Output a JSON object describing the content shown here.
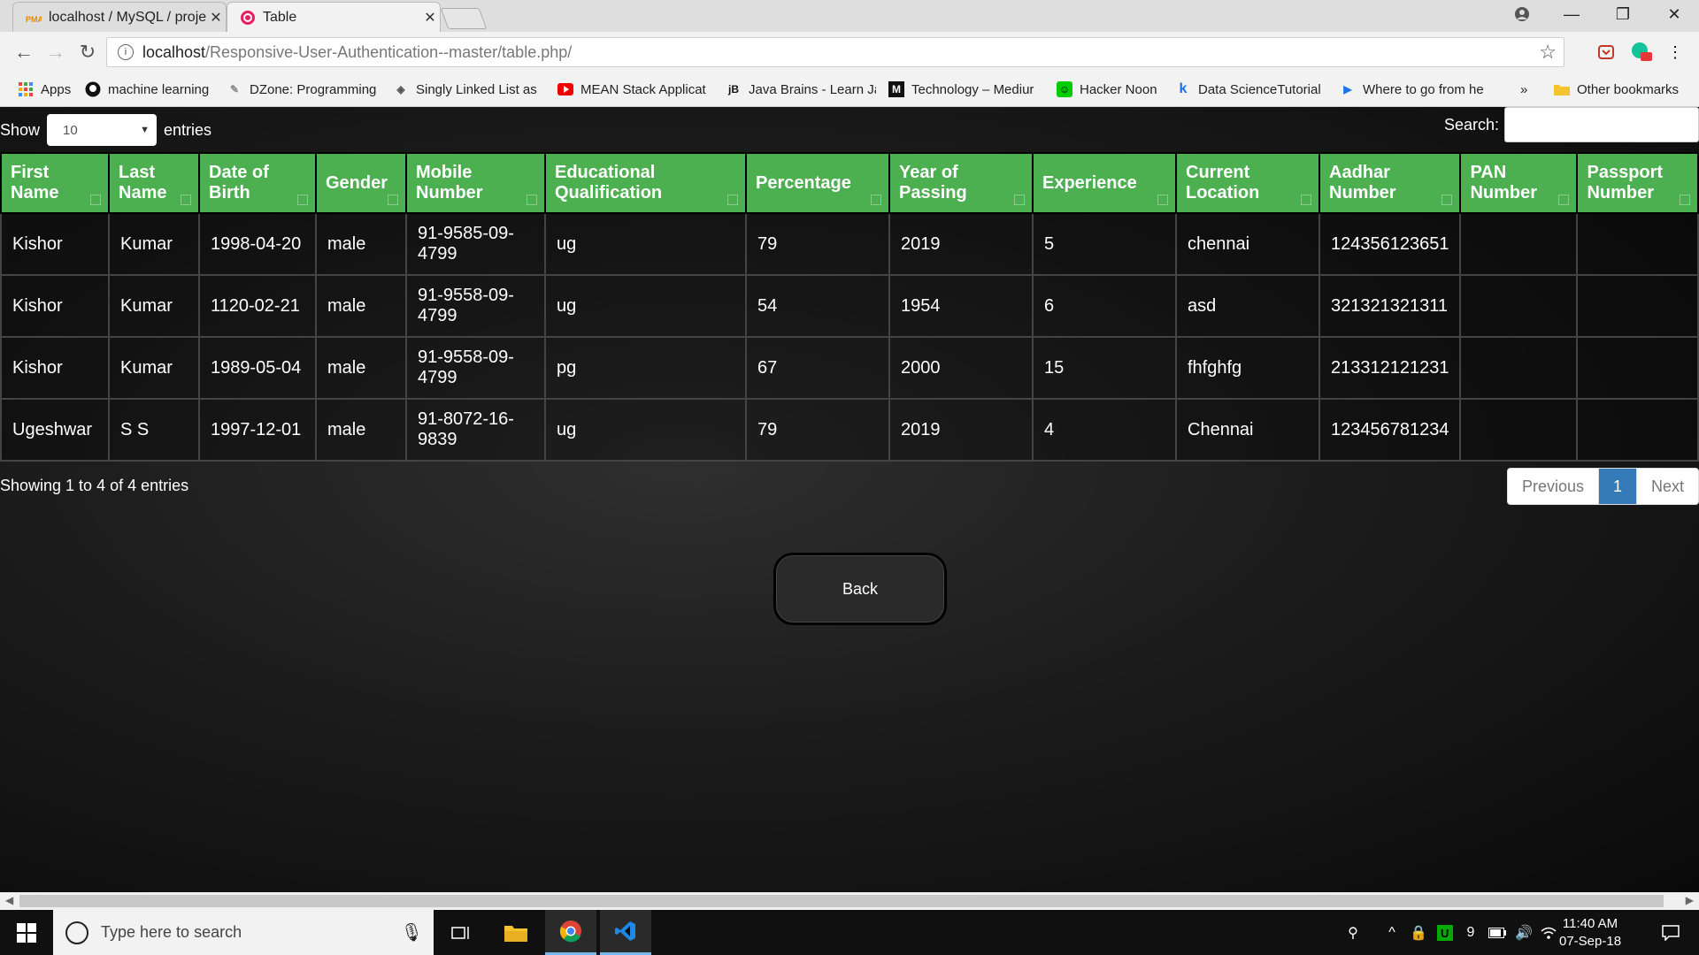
{
  "browser": {
    "tabs": [
      {
        "label": "localhost / MySQL / proje",
        "icon": "phpmyadmin-icon"
      },
      {
        "label": "Table",
        "icon": "page-favicon-icon"
      }
    ],
    "url_host": "localhost",
    "url_path": "/Responsive-User-Authentication--master/table.php/",
    "bookmarks": [
      {
        "label": "Apps",
        "icon": "apps-grid-icon"
      },
      {
        "label": "machine learning",
        "icon": "github-icon"
      },
      {
        "label": "DZone: Programming",
        "icon": "dzone-icon"
      },
      {
        "label": "Singly Linked List as",
        "icon": "diamond-icon"
      },
      {
        "label": "MEAN Stack Applicat",
        "icon": "youtube-icon"
      },
      {
        "label": "Java Brains - Learn Ja",
        "icon": "jb-icon"
      },
      {
        "label": "Technology – Mediur",
        "icon": "medium-icon"
      },
      {
        "label": "Hacker Noon",
        "icon": "hackernoon-icon"
      },
      {
        "label": "Data ScienceTutorial",
        "icon": "kdnuggets-icon"
      },
      {
        "label": "Where to go from he",
        "icon": "video-icon"
      },
      {
        "label": "»",
        "icon": ""
      },
      {
        "label": "Other bookmarks",
        "icon": "folder-icon"
      }
    ]
  },
  "controls": {
    "show_label": "Show",
    "entries_value": "10",
    "entries_label": "entries",
    "search_label": "Search:"
  },
  "table": {
    "headers": [
      "First Name",
      "Last Name",
      "Date of Birth",
      "Gender",
      "Mobile Number",
      "Educational Qualification",
      "Percentage",
      "Year of Passing",
      "Experience",
      "Current Location",
      "Aadhar Number",
      "PAN Number",
      "Passport Number"
    ],
    "rows": [
      [
        "Kishor",
        "Kumar",
        "1998-04-20",
        "male",
        "91-9585-09-4799",
        "ug",
        "79",
        "2019",
        "5",
        "chennai",
        "124356123651",
        "",
        ""
      ],
      [
        "Kishor",
        "Kumar",
        "1120-02-21",
        "male",
        "91-9558-09-4799",
        "ug",
        "54",
        "1954",
        "6",
        "asd",
        "321321321311",
        "",
        ""
      ],
      [
        "Kishor",
        "Kumar",
        "1989-05-04",
        "male",
        "91-9558-09-4799",
        "pg",
        "67",
        "2000",
        "15",
        "fhfghfg",
        "213312121231",
        "",
        ""
      ],
      [
        "Ugeshwar",
        "S S",
        "1997-12-01",
        "male",
        "91-8072-16-9839",
        "ug",
        "79",
        "2019",
        "4",
        "Chennai",
        "123456781234",
        "",
        ""
      ]
    ]
  },
  "footer": {
    "info": "Showing 1 to 4 of 4 entries",
    "prev": "Previous",
    "page": "1",
    "next": "Next"
  },
  "back_button": "Back",
  "taskbar": {
    "search_placeholder": "Type here to search",
    "tray_badge": "9",
    "time": "11:40 AM",
    "date": "07-Sep-18"
  },
  "colors": {
    "header_green": "#4caf50",
    "pager_active": "#337ab7"
  }
}
